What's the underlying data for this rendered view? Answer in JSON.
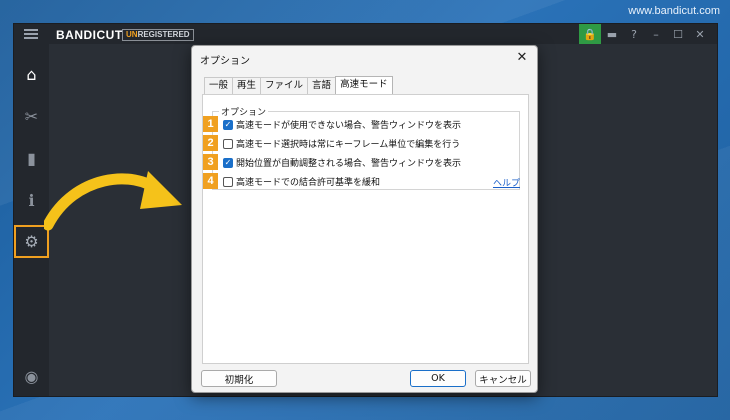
{
  "watermark": "www.bandicut.com",
  "app": {
    "logo": "BANDICUT",
    "badge_un": "UN",
    "badge_rest": "REGISTERED",
    "title_controls": [
      {
        "icon": "lock-icon",
        "glyph": "🔒"
      },
      {
        "icon": "folder-icon",
        "glyph": "▬"
      },
      {
        "icon": "help-icon",
        "glyph": "?"
      },
      {
        "icon": "minimize-icon",
        "glyph": "–"
      },
      {
        "icon": "maximize-icon",
        "glyph": "☐"
      },
      {
        "icon": "close-icon",
        "glyph": "✕"
      }
    ],
    "sidebar": [
      {
        "name": "home-icon",
        "glyph": "⌂"
      },
      {
        "name": "cut-icon",
        "glyph": "✂"
      },
      {
        "name": "film-icon",
        "glyph": "▮"
      },
      {
        "name": "info-icon",
        "glyph": "ℹ"
      },
      {
        "name": "gear-icon",
        "glyph": "⚙"
      },
      {
        "name": "record-icon",
        "glyph": "◉"
      }
    ]
  },
  "dialog": {
    "title": "オプション",
    "close": "✕",
    "tabs": [
      "一般",
      "再生",
      "ファイル",
      "言語",
      "高速モード"
    ],
    "active_tab": "高速モード",
    "group_label": "オプション",
    "options": [
      {
        "num": "1",
        "checked": true,
        "label": "高速モードが使用できない場合、警告ウィンドウを表示"
      },
      {
        "num": "2",
        "checked": false,
        "label": "高速モード選択時は常にキーフレーム単位で編集を行う"
      },
      {
        "num": "3",
        "checked": true,
        "label": "開始位置が自動調整される場合、警告ウィンドウを表示"
      },
      {
        "num": "4",
        "checked": false,
        "label": "高速モードでの結合許可基準を緩和"
      }
    ],
    "help": "ヘルプ",
    "buttons": {
      "reset": "初期化",
      "ok": "OK",
      "cancel": "キャンセル"
    }
  },
  "colors": {
    "accent": "#f0a020",
    "checkbox": "#1a6fc9",
    "app_bg": "#2a2f36",
    "desktop_bg": "#2a72b8"
  }
}
